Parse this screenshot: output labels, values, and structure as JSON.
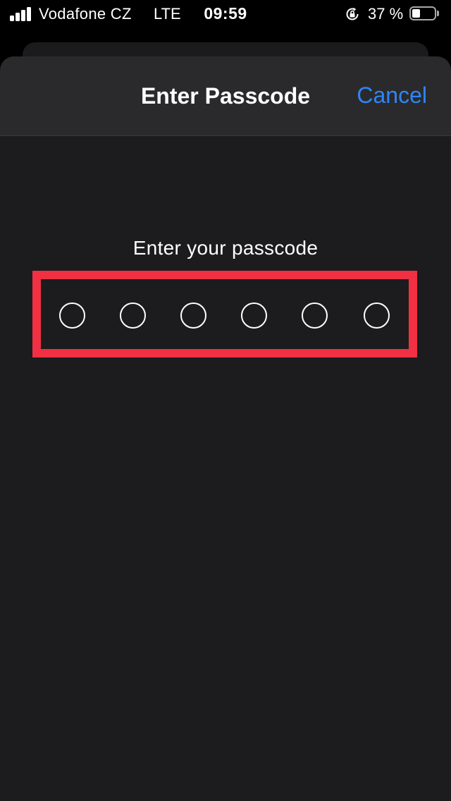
{
  "status_bar": {
    "carrier": "Vodafone CZ",
    "network": "LTE",
    "time": "09:59",
    "battery_percent_label": "37 %",
    "battery_level": 0.37,
    "icons": [
      "signal-bars-icon",
      "rotation-lock-icon",
      "battery-icon"
    ]
  },
  "nav": {
    "title": "Enter Passcode",
    "cancel_label": "Cancel"
  },
  "passcode": {
    "prompt": "Enter your passcode",
    "digits_total": 6,
    "digits_entered": 0
  },
  "colors": {
    "accent": "#2f86f5",
    "highlight_border": "#f13043",
    "sheet_background": "#1c1c1e",
    "nav_background": "#2a2a2c"
  }
}
